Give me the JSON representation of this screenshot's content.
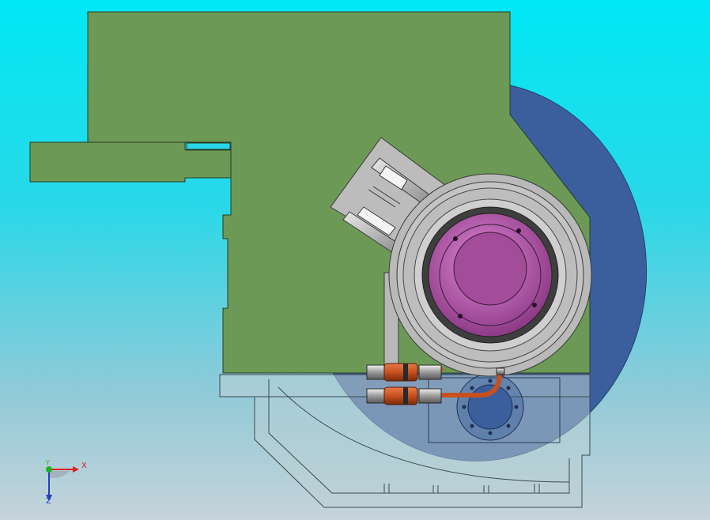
{
  "viewport": {
    "background_top": "#00e8f4",
    "background_bottom": "#c6d3da"
  },
  "model": {
    "housing_color": "#6c9a56",
    "disc_color": "#3a5f9c",
    "rotor_color": "#c07ab8",
    "hose_color": "#c8501e",
    "base_color": "#bcd0d4"
  },
  "triad": {
    "x_label": "X",
    "y_label": "Y",
    "z_label": "Z",
    "x_color": "#e02020",
    "y_color": "#20b020",
    "z_color": "#2040c0"
  }
}
